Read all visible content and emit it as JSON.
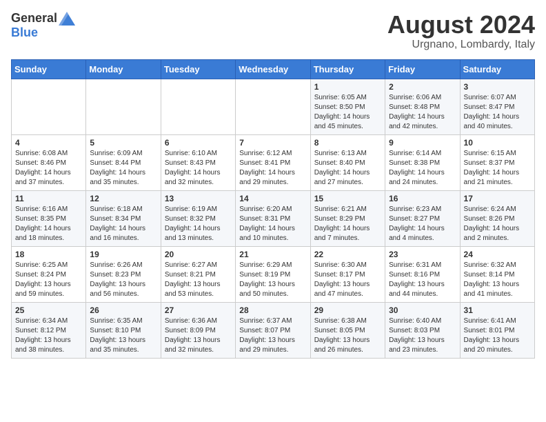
{
  "header": {
    "logo_general": "General",
    "logo_blue": "Blue",
    "month_year": "August 2024",
    "location": "Urgnano, Lombardy, Italy"
  },
  "weekdays": [
    "Sunday",
    "Monday",
    "Tuesday",
    "Wednesday",
    "Thursday",
    "Friday",
    "Saturday"
  ],
  "weeks": [
    [
      {
        "day": "",
        "info": ""
      },
      {
        "day": "",
        "info": ""
      },
      {
        "day": "",
        "info": ""
      },
      {
        "day": "",
        "info": ""
      },
      {
        "day": "1",
        "info": "Sunrise: 6:05 AM\nSunset: 8:50 PM\nDaylight: 14 hours\nand 45 minutes."
      },
      {
        "day": "2",
        "info": "Sunrise: 6:06 AM\nSunset: 8:48 PM\nDaylight: 14 hours\nand 42 minutes."
      },
      {
        "day": "3",
        "info": "Sunrise: 6:07 AM\nSunset: 8:47 PM\nDaylight: 14 hours\nand 40 minutes."
      }
    ],
    [
      {
        "day": "4",
        "info": "Sunrise: 6:08 AM\nSunset: 8:46 PM\nDaylight: 14 hours\nand 37 minutes."
      },
      {
        "day": "5",
        "info": "Sunrise: 6:09 AM\nSunset: 8:44 PM\nDaylight: 14 hours\nand 35 minutes."
      },
      {
        "day": "6",
        "info": "Sunrise: 6:10 AM\nSunset: 8:43 PM\nDaylight: 14 hours\nand 32 minutes."
      },
      {
        "day": "7",
        "info": "Sunrise: 6:12 AM\nSunset: 8:41 PM\nDaylight: 14 hours\nand 29 minutes."
      },
      {
        "day": "8",
        "info": "Sunrise: 6:13 AM\nSunset: 8:40 PM\nDaylight: 14 hours\nand 27 minutes."
      },
      {
        "day": "9",
        "info": "Sunrise: 6:14 AM\nSunset: 8:38 PM\nDaylight: 14 hours\nand 24 minutes."
      },
      {
        "day": "10",
        "info": "Sunrise: 6:15 AM\nSunset: 8:37 PM\nDaylight: 14 hours\nand 21 minutes."
      }
    ],
    [
      {
        "day": "11",
        "info": "Sunrise: 6:16 AM\nSunset: 8:35 PM\nDaylight: 14 hours\nand 18 minutes."
      },
      {
        "day": "12",
        "info": "Sunrise: 6:18 AM\nSunset: 8:34 PM\nDaylight: 14 hours\nand 16 minutes."
      },
      {
        "day": "13",
        "info": "Sunrise: 6:19 AM\nSunset: 8:32 PM\nDaylight: 14 hours\nand 13 minutes."
      },
      {
        "day": "14",
        "info": "Sunrise: 6:20 AM\nSunset: 8:31 PM\nDaylight: 14 hours\nand 10 minutes."
      },
      {
        "day": "15",
        "info": "Sunrise: 6:21 AM\nSunset: 8:29 PM\nDaylight: 14 hours\nand 7 minutes."
      },
      {
        "day": "16",
        "info": "Sunrise: 6:23 AM\nSunset: 8:27 PM\nDaylight: 14 hours\nand 4 minutes."
      },
      {
        "day": "17",
        "info": "Sunrise: 6:24 AM\nSunset: 8:26 PM\nDaylight: 14 hours\nand 2 minutes."
      }
    ],
    [
      {
        "day": "18",
        "info": "Sunrise: 6:25 AM\nSunset: 8:24 PM\nDaylight: 13 hours\nand 59 minutes."
      },
      {
        "day": "19",
        "info": "Sunrise: 6:26 AM\nSunset: 8:23 PM\nDaylight: 13 hours\nand 56 minutes."
      },
      {
        "day": "20",
        "info": "Sunrise: 6:27 AM\nSunset: 8:21 PM\nDaylight: 13 hours\nand 53 minutes."
      },
      {
        "day": "21",
        "info": "Sunrise: 6:29 AM\nSunset: 8:19 PM\nDaylight: 13 hours\nand 50 minutes."
      },
      {
        "day": "22",
        "info": "Sunrise: 6:30 AM\nSunset: 8:17 PM\nDaylight: 13 hours\nand 47 minutes."
      },
      {
        "day": "23",
        "info": "Sunrise: 6:31 AM\nSunset: 8:16 PM\nDaylight: 13 hours\nand 44 minutes."
      },
      {
        "day": "24",
        "info": "Sunrise: 6:32 AM\nSunset: 8:14 PM\nDaylight: 13 hours\nand 41 minutes."
      }
    ],
    [
      {
        "day": "25",
        "info": "Sunrise: 6:34 AM\nSunset: 8:12 PM\nDaylight: 13 hours\nand 38 minutes."
      },
      {
        "day": "26",
        "info": "Sunrise: 6:35 AM\nSunset: 8:10 PM\nDaylight: 13 hours\nand 35 minutes."
      },
      {
        "day": "27",
        "info": "Sunrise: 6:36 AM\nSunset: 8:09 PM\nDaylight: 13 hours\nand 32 minutes."
      },
      {
        "day": "28",
        "info": "Sunrise: 6:37 AM\nSunset: 8:07 PM\nDaylight: 13 hours\nand 29 minutes."
      },
      {
        "day": "29",
        "info": "Sunrise: 6:38 AM\nSunset: 8:05 PM\nDaylight: 13 hours\nand 26 minutes."
      },
      {
        "day": "30",
        "info": "Sunrise: 6:40 AM\nSunset: 8:03 PM\nDaylight: 13 hours\nand 23 minutes."
      },
      {
        "day": "31",
        "info": "Sunrise: 6:41 AM\nSunset: 8:01 PM\nDaylight: 13 hours\nand 20 minutes."
      }
    ]
  ]
}
